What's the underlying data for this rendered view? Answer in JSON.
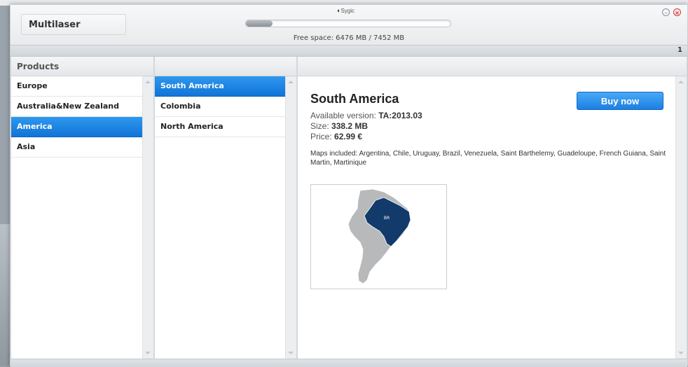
{
  "header": {
    "account_label": "Multilaser",
    "brand": "Sygic",
    "storage_used_fraction": 0.13,
    "free_space_text": "Free space: 6476 MB / 7452 MB"
  },
  "strip": {
    "page_number": "1"
  },
  "products": {
    "header": "Products",
    "items": [
      {
        "label": "Europe",
        "selected": false
      },
      {
        "label": "Australia&New Zealand",
        "selected": false
      },
      {
        "label": "America",
        "selected": true
      },
      {
        "label": "Asia",
        "selected": false
      }
    ]
  },
  "regions": {
    "items": [
      {
        "label": "South America",
        "selected": true
      },
      {
        "label": "Colombia",
        "selected": false
      },
      {
        "label": "North America",
        "selected": false
      }
    ]
  },
  "detail": {
    "title": "South America",
    "buy_label": "Buy now",
    "version_label": "Available version:",
    "version_value": "TA:2013.03",
    "size_label": "Size:",
    "size_value": "338.2 MB",
    "price_label": "Price:",
    "price_value": "62.99 €",
    "maps_included": "Maps included: Argentina, Chile, Uruguay, Brazil, Venezuela, Saint Barthelemy, Guadeloupe, French Guiana, Saint Martin, Martinique",
    "map_highlight_label": "BR",
    "colors": {
      "highlight": "#123a6b",
      "land": "#b7b9bb"
    }
  },
  "colors": {
    "accent": "#1a7ee3",
    "selected_row": "#1173d8"
  }
}
